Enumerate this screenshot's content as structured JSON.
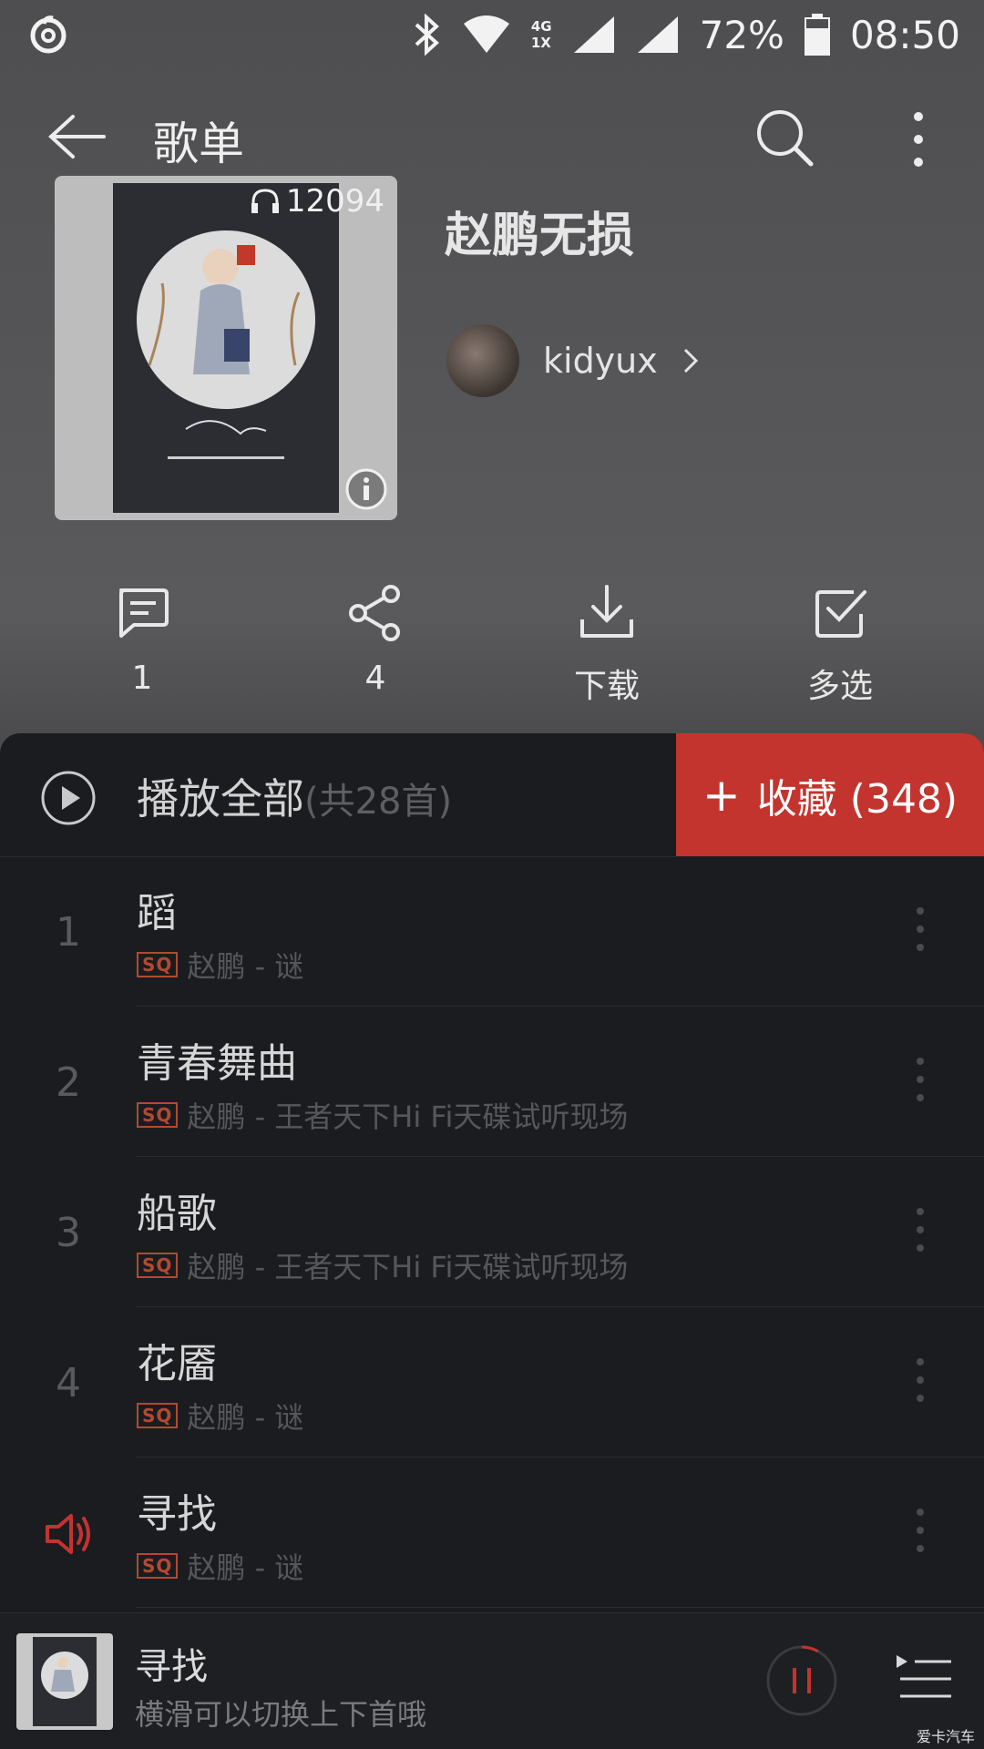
{
  "status_bar": {
    "network_small": "4G",
    "network_small2": "1X",
    "battery": "72%",
    "time": "08:50"
  },
  "header": {
    "title": "歌单"
  },
  "playlist": {
    "play_count": "12094",
    "name": "赵鹏无损",
    "creator": "kidyux"
  },
  "actions": [
    {
      "label": "1",
      "icon": "comment-icon"
    },
    {
      "label": "4",
      "icon": "share-icon"
    },
    {
      "label": "下载",
      "icon": "download-icon"
    },
    {
      "label": "多选",
      "icon": "multi-select-icon"
    }
  ],
  "play_all": {
    "label": "播放全部",
    "count": "(共28首)"
  },
  "collect": {
    "plus": "+",
    "label": "收藏 (348)"
  },
  "songs": [
    {
      "index": "1",
      "title": "蹈",
      "quality": "SQ",
      "meta": "赵鹏 - 谜",
      "playing": false
    },
    {
      "index": "2",
      "title": "青春舞曲",
      "quality": "SQ",
      "meta": "赵鹏 - 王者天下Hi Fi天碟试听现场",
      "playing": false
    },
    {
      "index": "3",
      "title": "船歌",
      "quality": "SQ",
      "meta": "赵鹏 - 王者天下Hi Fi天碟试听现场",
      "playing": false
    },
    {
      "index": "4",
      "title": "花靥",
      "quality": "SQ",
      "meta": "赵鹏 - 谜",
      "playing": false
    },
    {
      "index": "",
      "title": "寻找",
      "quality": "SQ",
      "meta": "赵鹏 - 谜",
      "playing": true
    }
  ],
  "mini_player": {
    "song": "寻找",
    "hint": "横滑可以切换上下首哦"
  },
  "watermark": "爱卡汽车",
  "colors": {
    "accent_red": "#c3342f",
    "sq_badge": "#b24a30"
  }
}
